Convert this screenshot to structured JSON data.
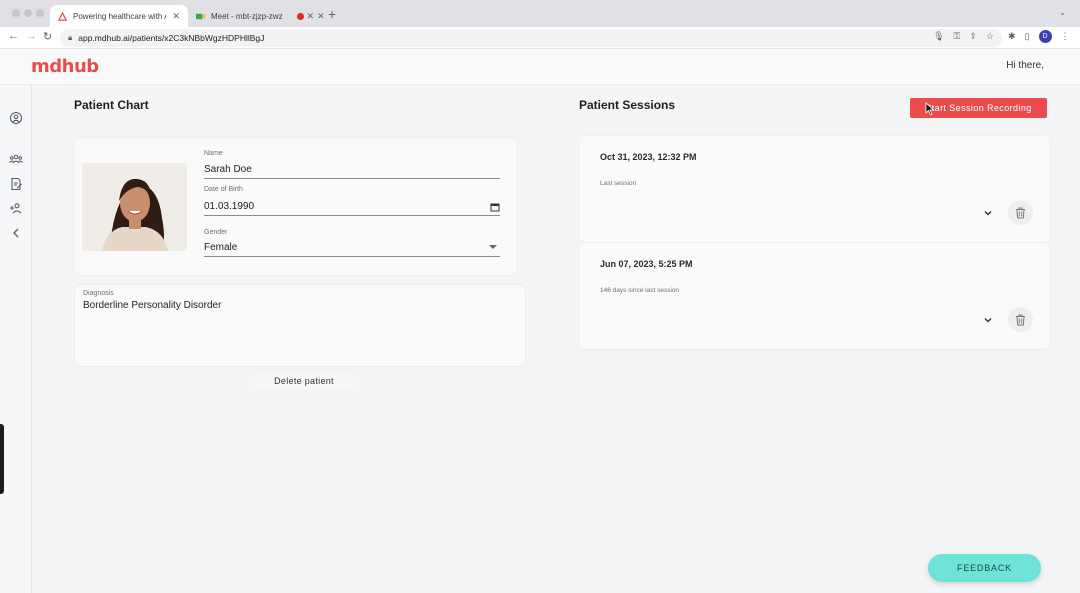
{
  "browser": {
    "tabs": [
      {
        "label": "Powering healthcare with AI.",
        "favicon": "mdhub-triangle-icon",
        "active": true
      },
      {
        "label": "Meet - mbt-zjzp-zwz",
        "favicon": "google-meet-icon",
        "active": false
      },
      {
        "label": "",
        "favicon": "recording-dot-icon",
        "active": false
      }
    ],
    "url_host": "app.mdhub.ai",
    "url_path": "/patients/x2C3kNBbWgzHDPHllBgJ",
    "profile_initial": "D"
  },
  "header": {
    "logo": "mdhub",
    "greeting": "Hi there,"
  },
  "patient_chart": {
    "title": "Patient Chart",
    "name_label": "Name",
    "name_value": "Sarah Doe",
    "dob_label": "Date of Birth",
    "dob_value": "01.03.1990",
    "gender_label": "Gender",
    "gender_value": "Female",
    "diagnosis_label": "Diagnosis",
    "diagnosis_value": "Borderline Personality Disorder",
    "delete_label": "Delete patient"
  },
  "sessions": {
    "title": "Patient Sessions",
    "record_label": "Start Session Recording",
    "items": [
      {
        "date": "Oct 31, 2023, 12:32 PM",
        "subtitle": "Last session"
      },
      {
        "date": "Jun 07, 2023, 5:25 PM",
        "subtitle": "146 days since last session"
      }
    ]
  },
  "feedback_label": "FEEDBACK",
  "colors": {
    "brand": "#ea4b4d",
    "feedback": "#6fe3d6"
  }
}
